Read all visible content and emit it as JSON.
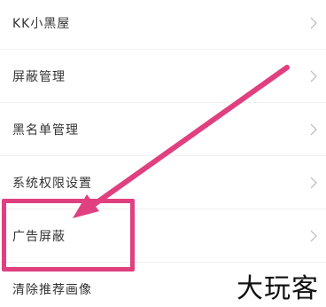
{
  "menu": {
    "items": [
      {
        "label": "KK小黑屋"
      },
      {
        "label": "屏蔽管理"
      },
      {
        "label": "黑名单管理"
      },
      {
        "label": "系统权限设置"
      },
      {
        "label": "广告屏蔽"
      },
      {
        "label": "清除推荐画像"
      }
    ]
  },
  "annotation": {
    "color": "#e0407f",
    "highlighted_item": "广告屏蔽"
  },
  "watermark": {
    "text": "大玩客"
  },
  "icons": {
    "row_chevron": "chevron-right-icon"
  }
}
